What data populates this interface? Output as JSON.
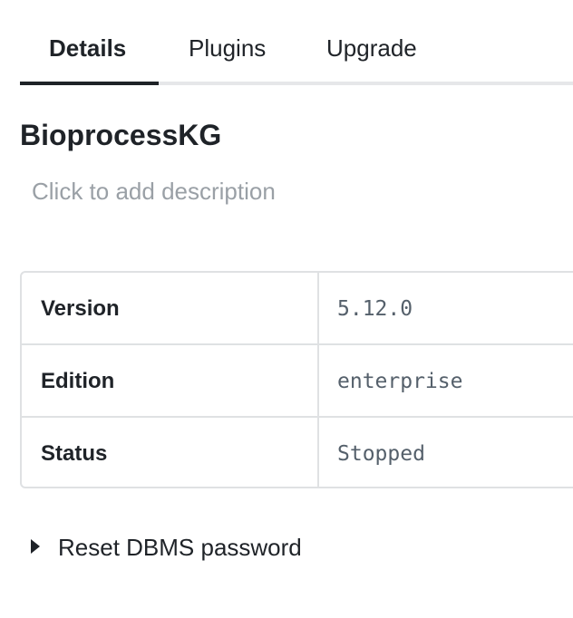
{
  "tabs": [
    {
      "label": "Details",
      "active": true
    },
    {
      "label": "Plugins",
      "active": false
    },
    {
      "label": "Upgrade",
      "active": false
    }
  ],
  "dbms": {
    "name": "BioprocessKG",
    "description_placeholder": "Click to add description"
  },
  "info": {
    "rows": [
      {
        "label": "Version",
        "value": "5.12.0"
      },
      {
        "label": "Edition",
        "value": "enterprise"
      },
      {
        "label": "Status",
        "value": "Stopped"
      }
    ]
  },
  "reset_password": {
    "label": "Reset DBMS password",
    "expanded": false,
    "icon": "caret-right-icon"
  }
}
